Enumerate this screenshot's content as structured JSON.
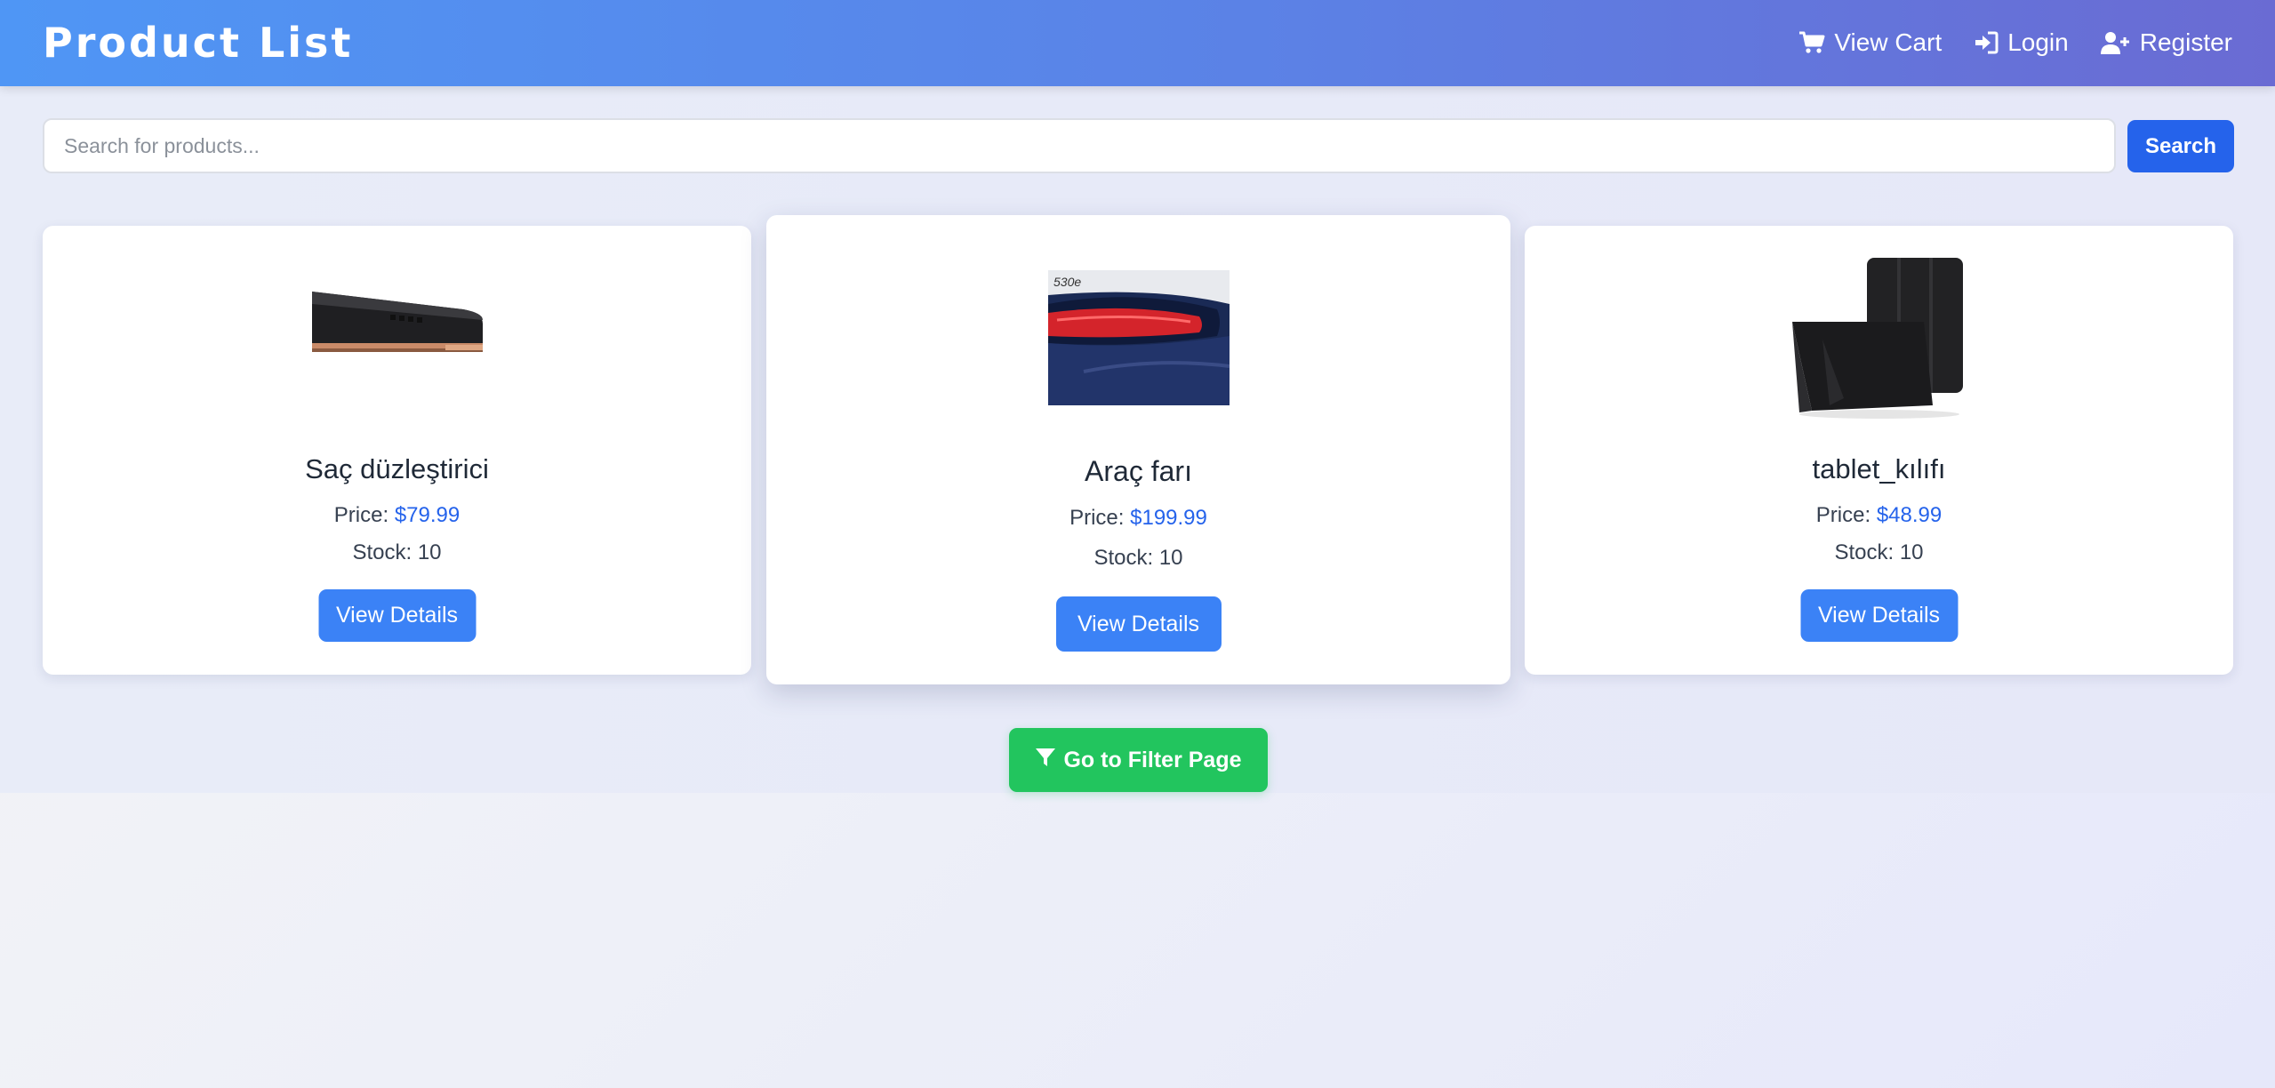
{
  "header": {
    "title": "Product List",
    "nav": {
      "cart_label": "View Cart",
      "login_label": "Login",
      "register_label": "Register"
    }
  },
  "search": {
    "placeholder": "Search for products...",
    "value": "",
    "button_label": "Search"
  },
  "products": [
    {
      "name": "Saç düzleştirici",
      "price_label": "Price:",
      "price": "$79.99",
      "stock": "Stock: 10",
      "button_label": "View Details"
    },
    {
      "name": "Araç farı",
      "price_label": "Price:",
      "price": "$199.99",
      "stock": "Stock: 10",
      "button_label": "View Details"
    },
    {
      "name": "tablet_kılıfı",
      "price_label": "Price:",
      "price": "$48.99",
      "stock": "Stock: 10",
      "button_label": "View Details"
    }
  ],
  "filter": {
    "button_label": "Go to Filter Page"
  },
  "icons": {
    "cart": "cart-icon",
    "login": "sign-in-icon",
    "register": "user-plus-icon",
    "filter": "filter-icon"
  },
  "colors": {
    "header_start": "#4f96f5",
    "header_end": "#6a6bd3",
    "primary": "#2563eb",
    "button_blue": "#3b82f6",
    "filter_green": "#22c55e"
  }
}
